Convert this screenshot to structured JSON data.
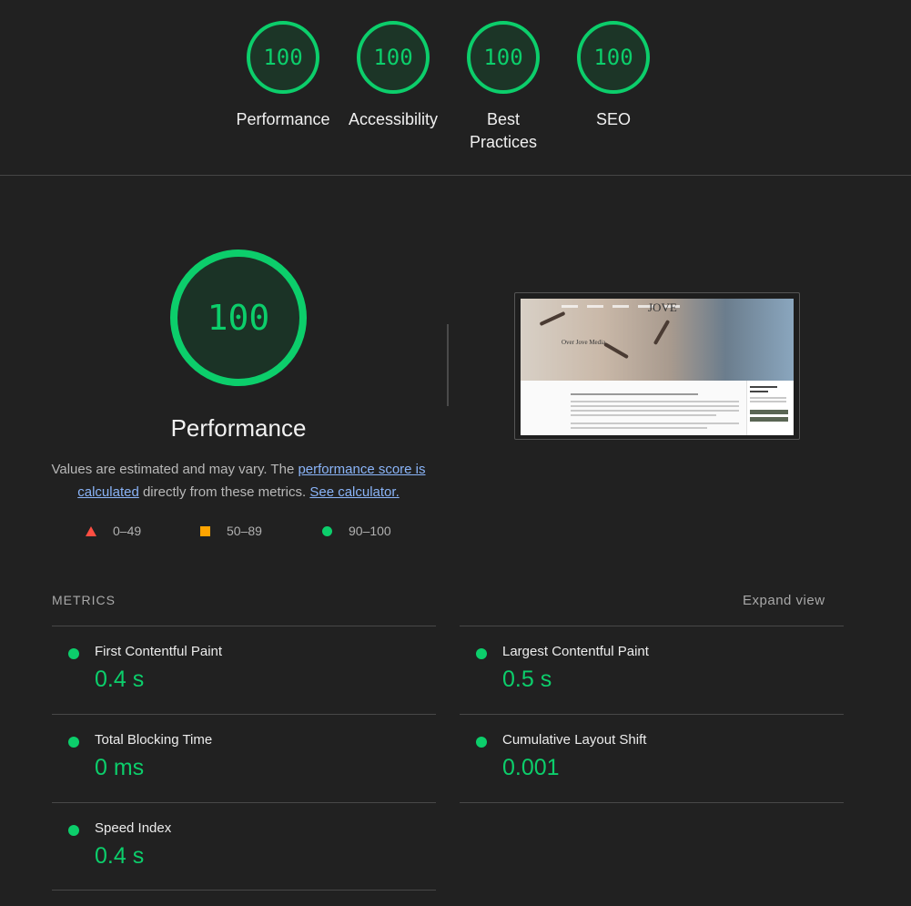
{
  "top_gauges": [
    {
      "score": "100",
      "label": "Performance"
    },
    {
      "score": "100",
      "label": "Accessibility"
    },
    {
      "score": "100",
      "label": "Best Practices"
    },
    {
      "score": "100",
      "label": "SEO"
    }
  ],
  "main": {
    "score": "100",
    "title": "Performance",
    "description_pre": "Values are estimated and may vary. The ",
    "description_link1": "performance score is calculated",
    "description_mid": " directly from these metrics. ",
    "description_link2": "See calculator."
  },
  "legend": {
    "fail": "0–49",
    "average": "50–89",
    "pass": "90–100"
  },
  "screenshot": {
    "brand": "JOVE",
    "caption": "Over Jove Media"
  },
  "metrics": {
    "header": "METRICS",
    "expand": "Expand view",
    "items": [
      {
        "name": "First Contentful Paint",
        "value": "0.4 s"
      },
      {
        "name": "Largest Contentful Paint",
        "value": "0.5 s"
      },
      {
        "name": "Total Blocking Time",
        "value": "0 ms"
      },
      {
        "name": "Cumulative Layout Shift",
        "value": "0.001"
      },
      {
        "name": "Speed Index",
        "value": "0.4 s"
      }
    ]
  },
  "colors": {
    "pass": "#0cce6b",
    "average": "#ffa400",
    "fail": "#ff4e42",
    "background": "#212121"
  }
}
